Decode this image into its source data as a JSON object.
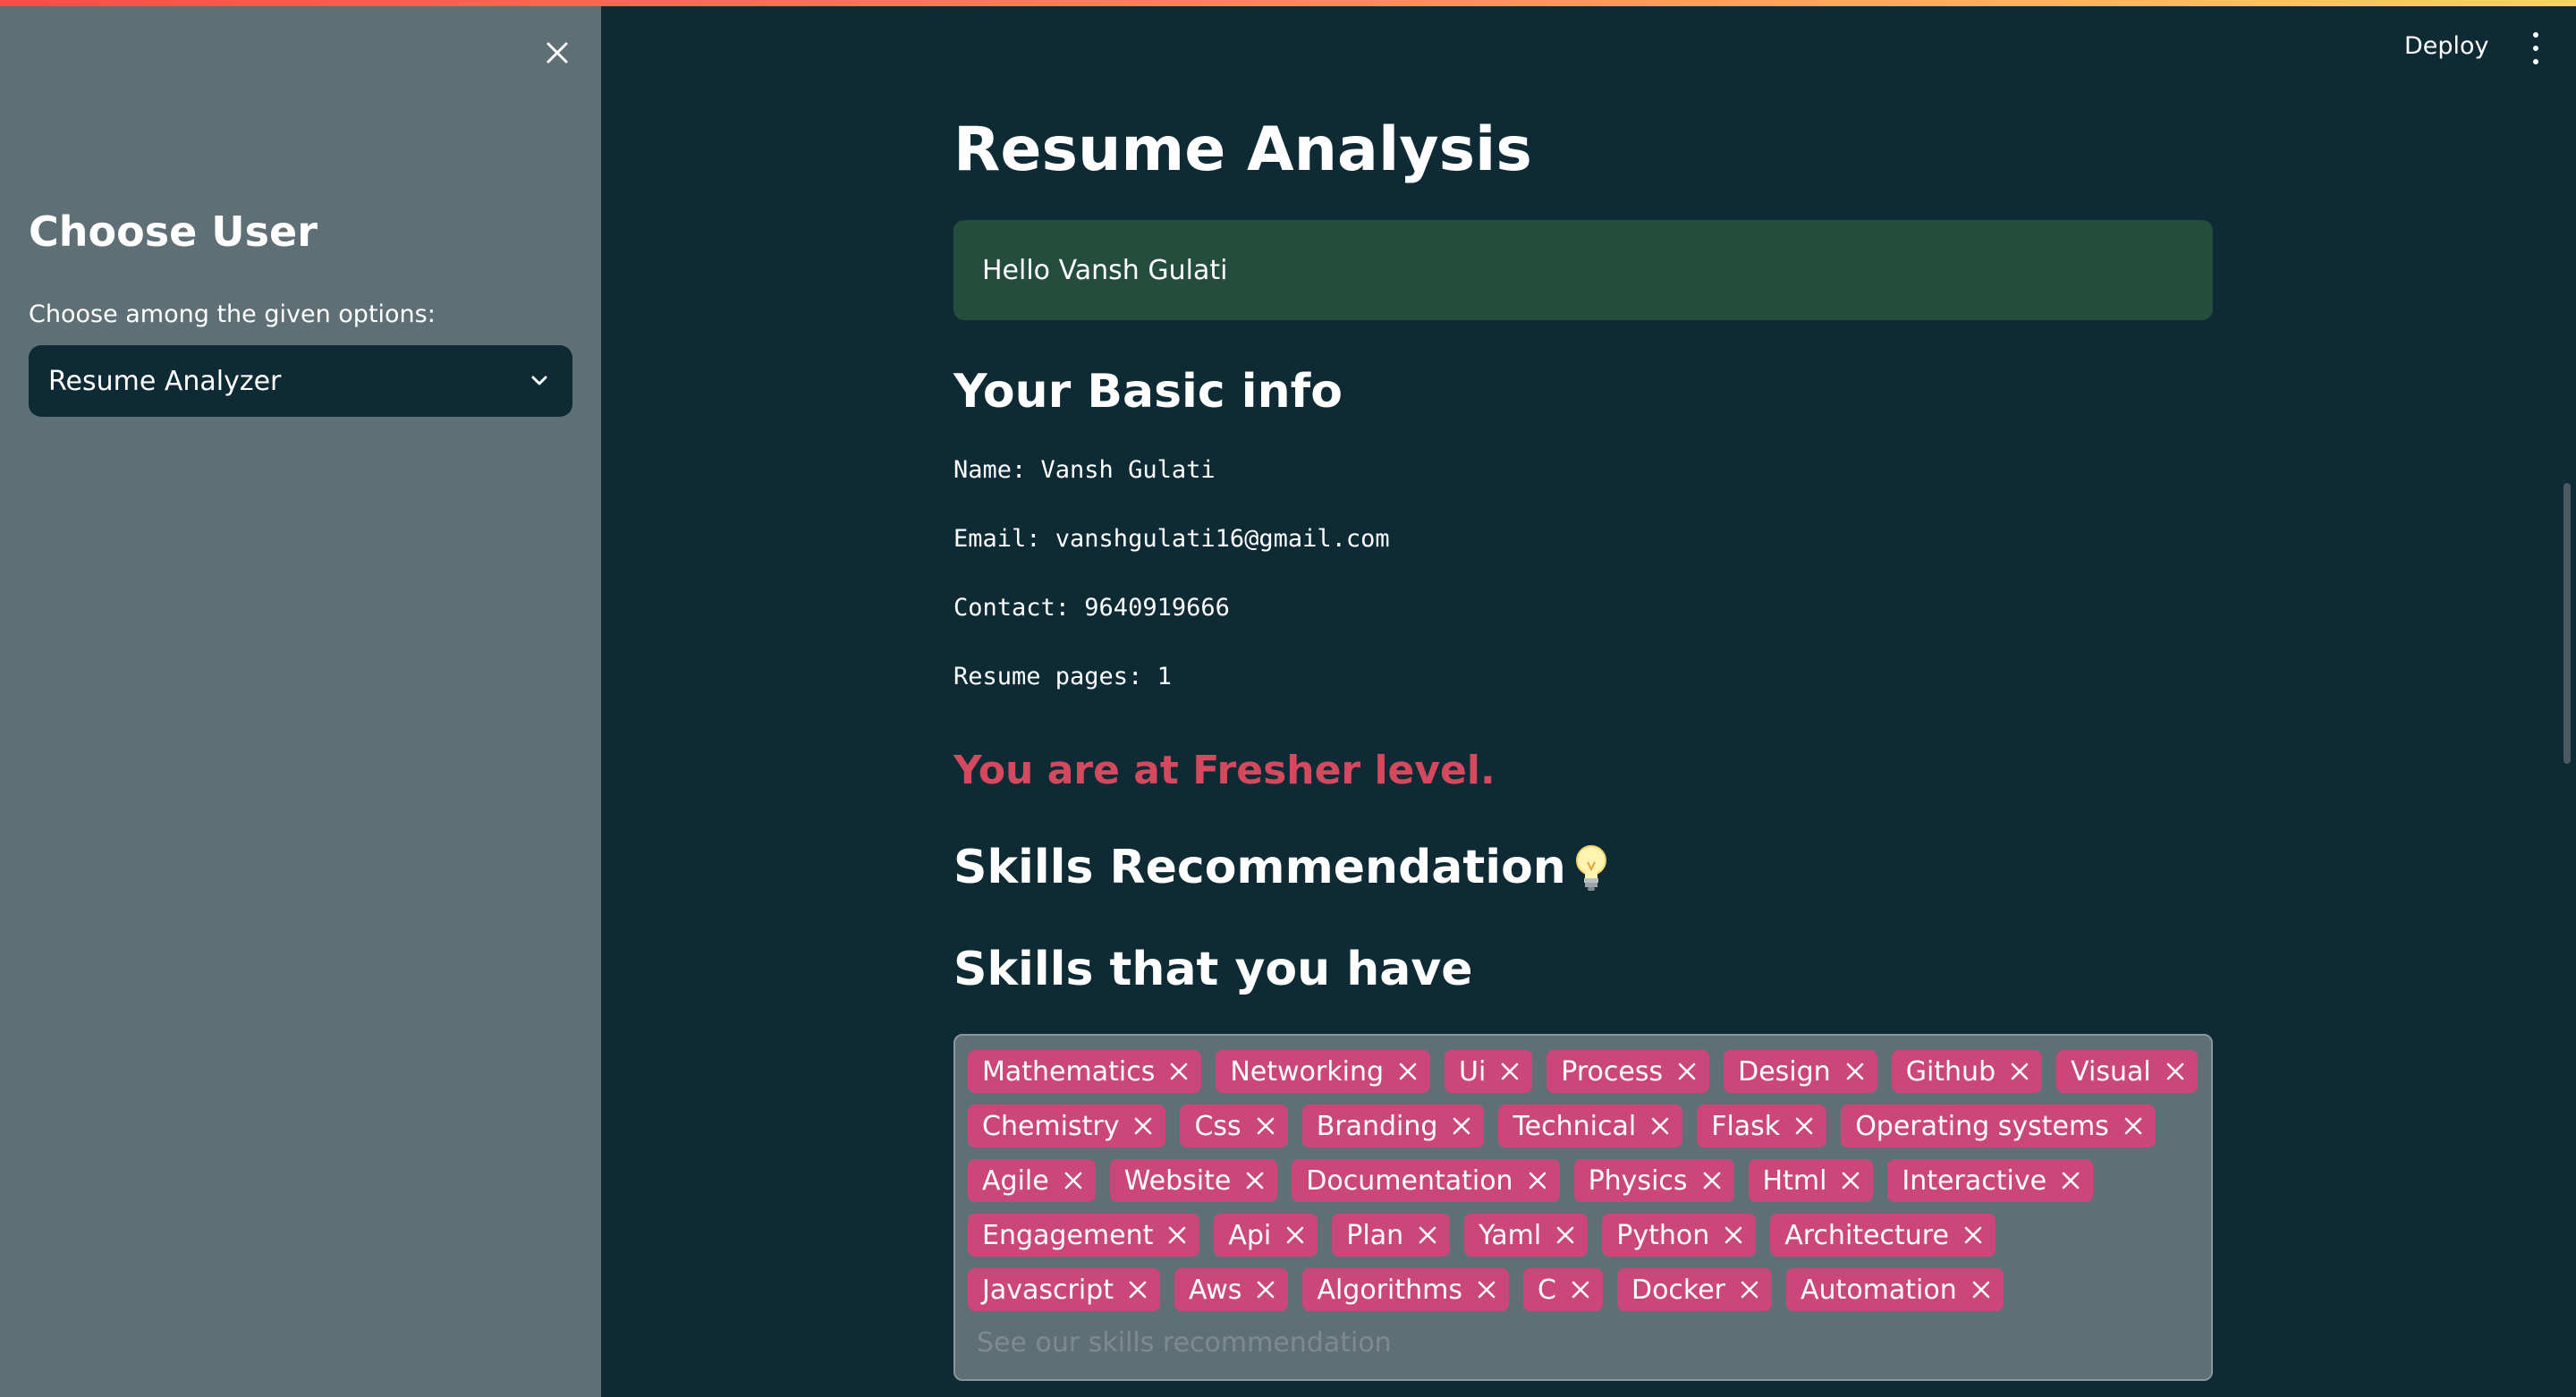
{
  "sidebar": {
    "title": "Choose User",
    "select_label": "Choose among the given options:",
    "select_value": "Resume Analyzer",
    "close_icon": "close-icon",
    "chevron_icon": "chevron-down-icon"
  },
  "header": {
    "deploy_label": "Deploy",
    "menu_icon": "kebab-menu-icon"
  },
  "main": {
    "title": "Resume Analysis",
    "greeting": "Hello Vansh Gulati",
    "basic_info_heading": "Your Basic info",
    "info": {
      "name": "Name: Vansh Gulati",
      "email": "Email: vanshgulati16@gmail.com",
      "contact": "Contact: 9640919666",
      "pages": "Resume pages: 1"
    },
    "level": "You are at Fresher level.",
    "skills_rec_heading": "Skills Recommendation",
    "skills_rec_icon": "lightbulb-icon",
    "skills_have_heading": "Skills that you have",
    "skills_placeholder": "See our skills recommendation",
    "skills_rows": [
      [
        "Mathematics",
        "Networking",
        "Ui",
        "Process",
        "Design",
        "Github",
        "Visual"
      ],
      [
        "Chemistry",
        "Css",
        "Branding",
        "Technical",
        "Flask",
        "Operating systems"
      ],
      [
        "Agile",
        "Website",
        "Documentation",
        "Physics",
        "Html",
        "Interactive"
      ],
      [
        "Engagement",
        "Api",
        "Plan",
        "Yaml",
        "Python",
        "Architecture"
      ],
      [
        "Javascript",
        "Aws",
        "Algorithms",
        "C",
        "Docker",
        "Automation"
      ]
    ]
  },
  "colors": {
    "main_bg": "#0e2a35",
    "sidebar_bg": "#5f6f76",
    "greeting_bg": "#244d3e",
    "level_text": "#d5495e",
    "chip_bg": "#cc4779"
  }
}
